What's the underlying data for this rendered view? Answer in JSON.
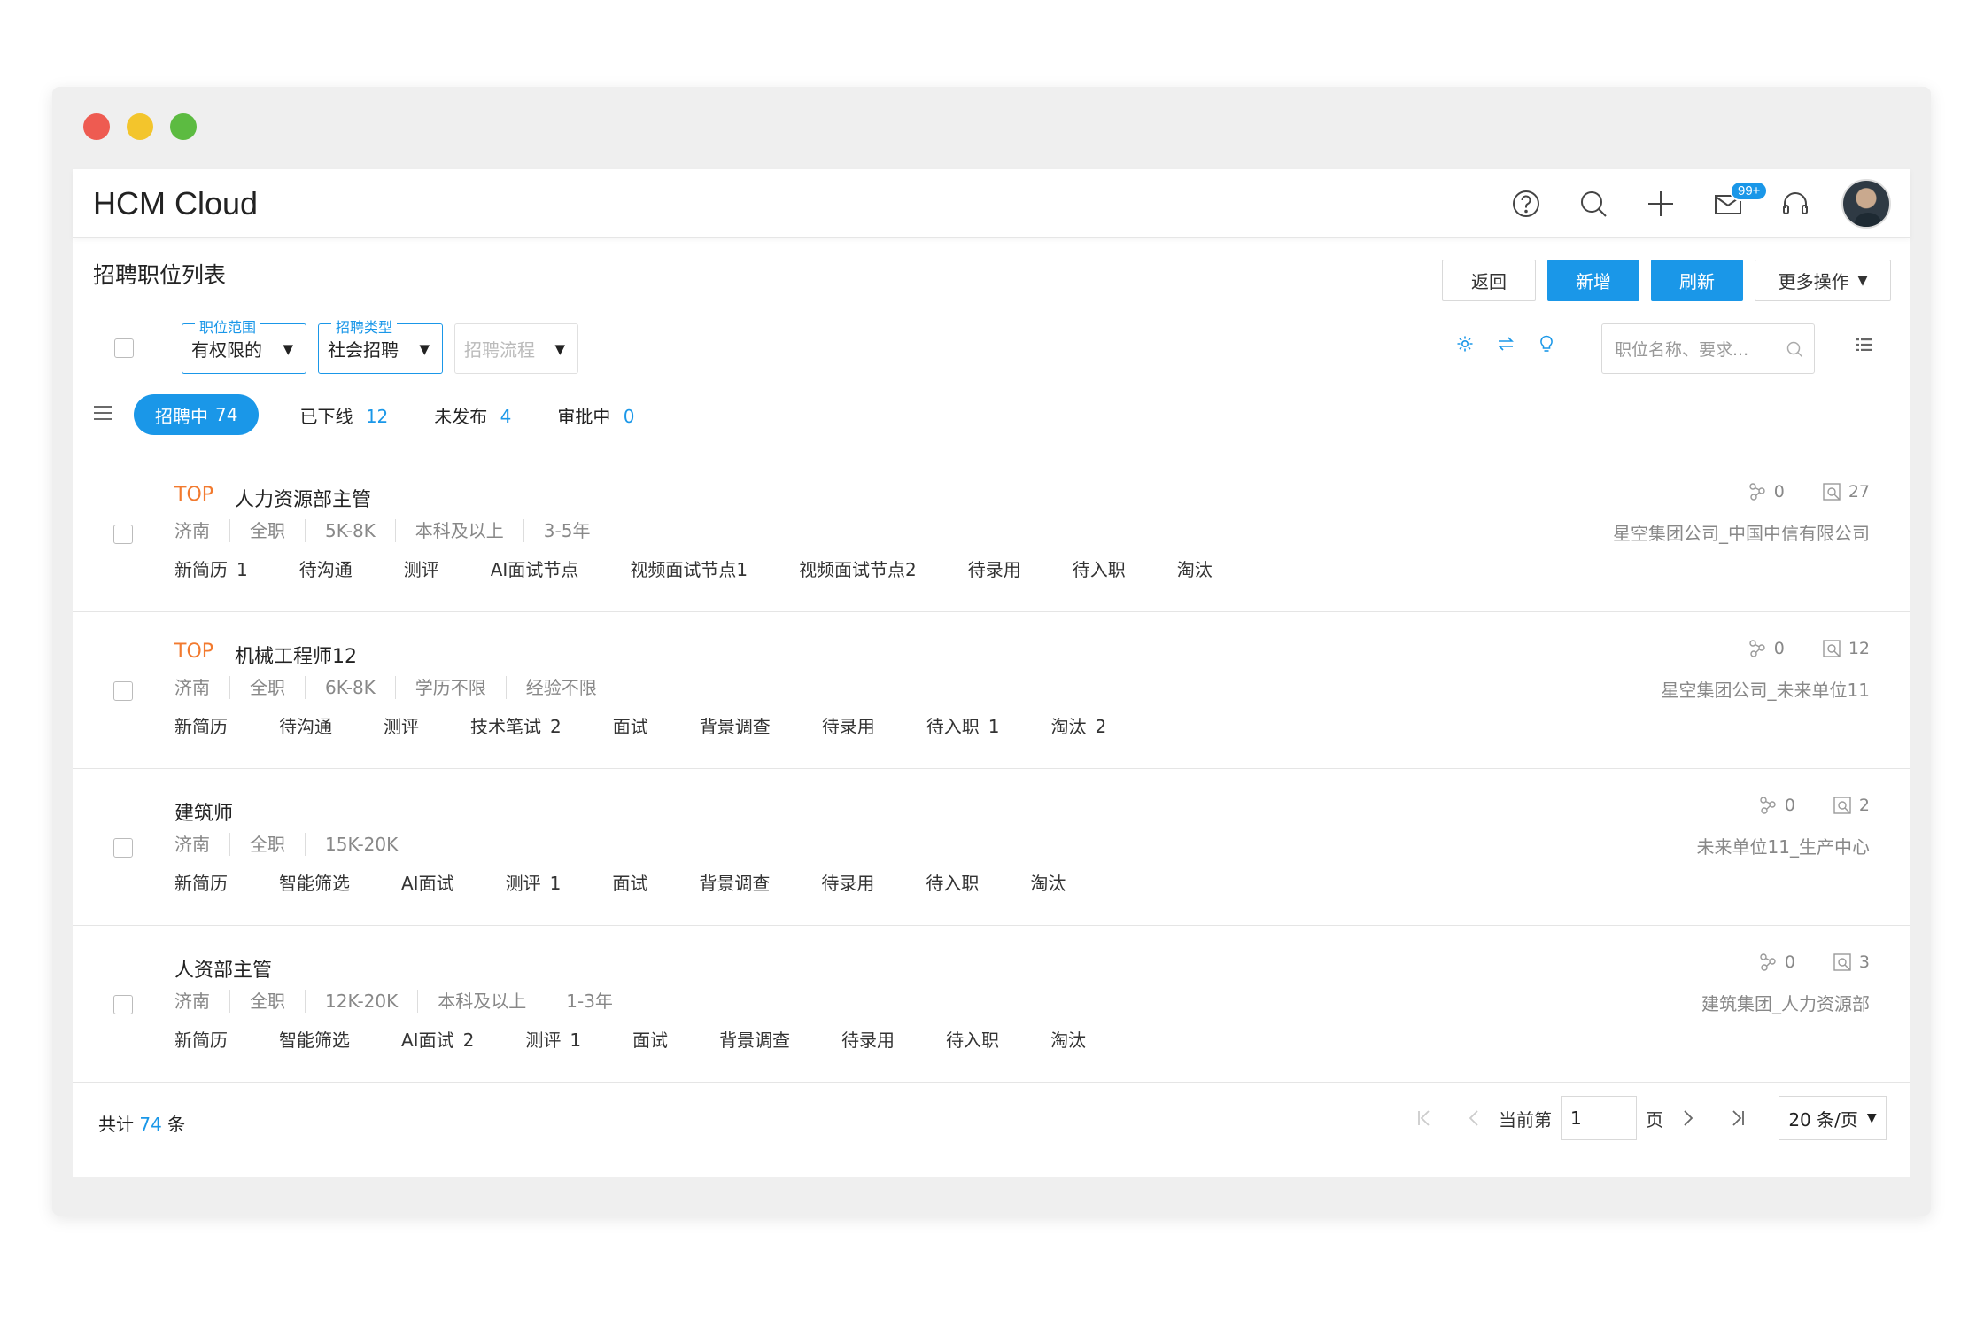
{
  "app": {
    "title": "HCM Cloud",
    "mail_badge": "99+"
  },
  "page": {
    "title": "招聘职位列表"
  },
  "actions": {
    "back": "返回",
    "add": "新增",
    "refresh": "刷新",
    "more": "更多操作"
  },
  "filters": {
    "scope_label": "职位范围",
    "scope_value": "有权限的",
    "type_label": "招聘类型",
    "type_value": "社会招聘",
    "process_placeholder": "招聘流程",
    "search_placeholder": "职位名称、要求..."
  },
  "tabs": [
    {
      "label": "招聘中",
      "count": "74"
    },
    {
      "label": "已下线",
      "count": "12"
    },
    {
      "label": "未发布",
      "count": "4"
    },
    {
      "label": "审批中",
      "count": "0"
    }
  ],
  "jobs": [
    {
      "top": "TOP",
      "title": "人力资源部主管",
      "meta": [
        "济南",
        "全职",
        "5K-8K",
        "本科及以上",
        "3-5年"
      ],
      "stages": [
        {
          "name": "新简历",
          "count": "1"
        },
        {
          "name": "待沟通",
          "count": ""
        },
        {
          "name": "测评",
          "count": ""
        },
        {
          "name": "AI面试节点",
          "count": ""
        },
        {
          "name": "视频面试节点1",
          "count": ""
        },
        {
          "name": "视频面试节点2",
          "count": ""
        },
        {
          "name": "待录用",
          "count": ""
        },
        {
          "name": "待入职",
          "count": ""
        },
        {
          "name": "淘汰",
          "count": ""
        }
      ],
      "shares": "0",
      "views": "27",
      "org": "星空集团公司_中国中信有限公司"
    },
    {
      "top": "TOP",
      "title": "机械工程师12",
      "meta": [
        "济南",
        "全职",
        "6K-8K",
        "学历不限",
        "经验不限"
      ],
      "stages": [
        {
          "name": "新简历",
          "count": ""
        },
        {
          "name": "待沟通",
          "count": ""
        },
        {
          "name": "测评",
          "count": ""
        },
        {
          "name": "技术笔试",
          "count": "2"
        },
        {
          "name": "面试",
          "count": ""
        },
        {
          "name": "背景调查",
          "count": ""
        },
        {
          "name": "待录用",
          "count": ""
        },
        {
          "name": "待入职",
          "count": "1"
        },
        {
          "name": "淘汰",
          "count": "2"
        }
      ],
      "shares": "0",
      "views": "12",
      "org": "星空集团公司_未来单位11"
    },
    {
      "top": "",
      "title": "建筑师",
      "meta": [
        "济南",
        "全职",
        "15K-20K"
      ],
      "stages": [
        {
          "name": "新简历",
          "count": ""
        },
        {
          "name": "智能筛选",
          "count": ""
        },
        {
          "name": "AI面试",
          "count": ""
        },
        {
          "name": "测评",
          "count": "1"
        },
        {
          "name": "面试",
          "count": ""
        },
        {
          "name": "背景调查",
          "count": ""
        },
        {
          "name": "待录用",
          "count": ""
        },
        {
          "name": "待入职",
          "count": ""
        },
        {
          "name": "淘汰",
          "count": ""
        }
      ],
      "shares": "0",
      "views": "2",
      "org": "未来单位11_生产中心"
    },
    {
      "top": "",
      "title": "人资部主管",
      "meta": [
        "济南",
        "全职",
        "12K-20K",
        "本科及以上",
        "1-3年"
      ],
      "stages": [
        {
          "name": "新简历",
          "count": ""
        },
        {
          "name": "智能筛选",
          "count": ""
        },
        {
          "name": "AI面试",
          "count": "2"
        },
        {
          "name": "测评",
          "count": "1"
        },
        {
          "name": "面试",
          "count": ""
        },
        {
          "name": "背景调查",
          "count": ""
        },
        {
          "name": "待录用",
          "count": ""
        },
        {
          "name": "待入职",
          "count": ""
        },
        {
          "name": "淘汰",
          "count": ""
        }
      ],
      "shares": "0",
      "views": "3",
      "org": "建筑集团_人力资源部"
    }
  ],
  "footer": {
    "total_prefix": "共计",
    "total": "74",
    "total_suffix": "条",
    "current_label": "当前第",
    "current_page": "1",
    "page_suffix": "页",
    "page_size": "20 条/页"
  },
  "colors": {
    "primary": "#1a97e8",
    "top_tag": "#f27a2f"
  }
}
